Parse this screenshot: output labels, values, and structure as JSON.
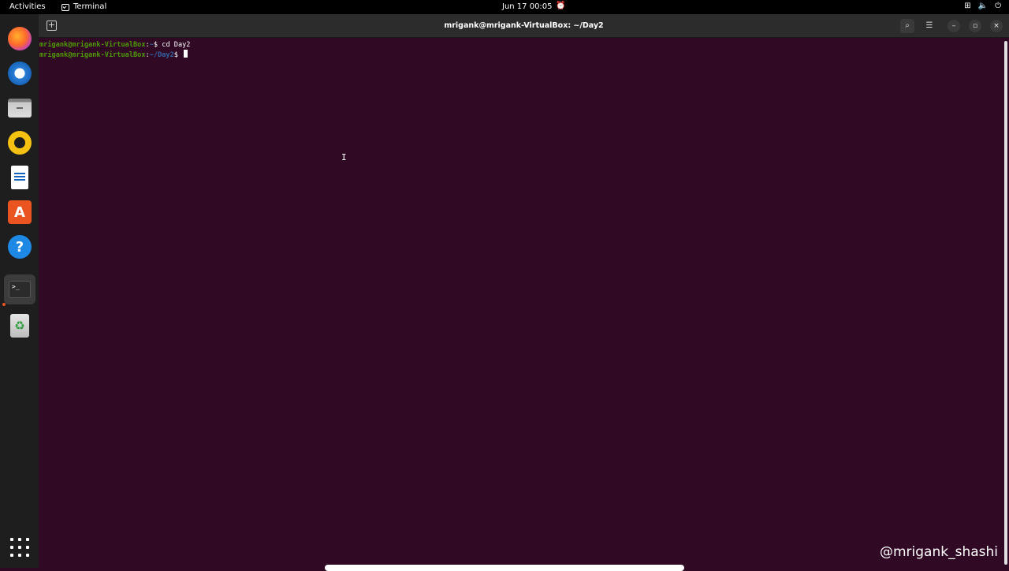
{
  "topbar": {
    "activities": "Activities",
    "app_name": "Terminal",
    "clock": "Jun 17  00:05"
  },
  "window": {
    "title": "mrigank@mrigank-VirtualBox: ~/Day2"
  },
  "terminal": {
    "lines": [
      {
        "user_host": "mrigank@mrigank-VirtualBox",
        "path": "~",
        "prompt_end": "$ ",
        "command": "cd Day2"
      },
      {
        "user_host": "mrigank@mrigank-VirtualBox",
        "path": "~/Day2",
        "prompt_end": "$ ",
        "command": ""
      }
    ],
    "separator": ":"
  },
  "dock": {
    "icons": [
      "firefox-icon",
      "thunderbird-icon",
      "files-icon",
      "rhythmbox-icon",
      "libreoffice-writer-icon",
      "app-center-icon",
      "help-icon",
      "terminal-icon",
      "trash-icon",
      "show-apps-icon"
    ],
    "help_glyph": "?",
    "store_glyph": "A",
    "terminal_glyph": ">_",
    "trash_glyph": "♻"
  },
  "watermark": "@mrigank_shashi",
  "colors": {
    "terminal_bg": "#300a24",
    "prompt_user": "#4e9a06",
    "prompt_path": "#3465a4",
    "accent": "#e95420"
  }
}
